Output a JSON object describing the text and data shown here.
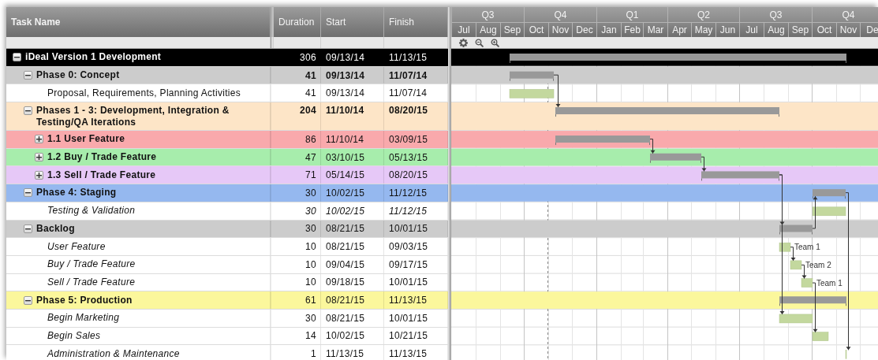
{
  "columns": [
    {
      "label": "Task Name"
    },
    {
      "label": "Duration"
    },
    {
      "label": "Start"
    },
    {
      "label": "Finish"
    }
  ],
  "timeline": {
    "quarters": [
      {
        "label": "Q3",
        "months": [
          "Jul",
          "Aug",
          "Sep"
        ]
      },
      {
        "label": "Q4",
        "months": [
          "Oct",
          {
            "label": "Nov",
            "today": true
          },
          "Dec"
        ]
      },
      {
        "label": "Q1",
        "months": [
          "Jan",
          "Feb",
          "Mar"
        ]
      },
      {
        "label": "Q2",
        "months": [
          "Apr",
          "May",
          "Jun"
        ]
      },
      {
        "label": "Q3",
        "months": [
          "Jul",
          "Aug",
          "Sep"
        ]
      },
      {
        "label": "Q4",
        "months": [
          "Oct",
          "Nov",
          "De"
        ]
      }
    ]
  },
  "rows": [
    {
      "name": "iDeal Version 1 Development",
      "kind": "group",
      "expanded": true,
      "color": "#000000",
      "duration": "306",
      "start": "09/13/14",
      "finish": "11/13/15",
      "children": [
        {
          "name": "Phase 0: Concept",
          "kind": "summary",
          "expanded": true,
          "color": "#cccccc",
          "duration": "41",
          "start": "09/13/14",
          "finish": "11/07/14",
          "children": [
            {
              "name": "Proposal, Requirements, Planning Activities",
              "kind": "task",
              "italic": false,
              "duration": "41",
              "start": "09/13/14",
              "finish": "11/07/14"
            }
          ]
        },
        {
          "name": "Phases 1 - 3: Development, Integration & Testing/QA Iterations",
          "kind": "summary",
          "expanded": true,
          "color": "#fde5c7",
          "duration": "204",
          "start": "11/10/14",
          "finish": "08/20/15",
          "children": [
            {
              "name": "1.1 User Feature",
              "kind": "group",
              "expanded": false,
              "color": "#f9a9ac",
              "duration": "86",
              "start": "11/10/14",
              "finish": "03/09/15"
            },
            {
              "name": "1.2 Buy / Trade Feature",
              "kind": "group",
              "expanded": false,
              "color": "#a7edac",
              "duration": "47",
              "start": "03/10/15",
              "finish": "05/13/15"
            },
            {
              "name": "1.3 Sell / Trade Feature",
              "kind": "group",
              "expanded": false,
              "color": "#e6c8f7",
              "duration": "71",
              "start": "05/14/15",
              "finish": "08/20/15"
            }
          ]
        },
        {
          "name": "Phase 4: Staging",
          "kind": "group",
          "expanded": true,
          "color": "#95b8ef",
          "duration": "30",
          "start": "10/02/15",
          "finish": "11/12/15",
          "children": [
            {
              "name": "Testing & Validation",
              "kind": "task",
              "italic": true,
              "italic_values": true,
              "duration": "30",
              "start": "10/02/15",
              "finish": "11/12/15"
            }
          ]
        },
        {
          "name": "Backlog",
          "kind": "group",
          "expanded": true,
          "color": "#cccccc",
          "duration": "30",
          "start": "08/21/15",
          "finish": "10/01/15",
          "children": [
            {
              "name": "User Feature",
              "kind": "task",
              "italic": true,
              "duration": "10",
              "start": "08/21/15",
              "finish": "09/03/15",
              "bar_label": "Team 1"
            },
            {
              "name": "Buy / Trade Feature",
              "kind": "task",
              "italic": true,
              "duration": "10",
              "start": "09/04/15",
              "finish": "09/17/15",
              "bar_label": "Team 2"
            },
            {
              "name": "Sell / Trade Feature",
              "kind": "task",
              "italic": true,
              "duration": "10",
              "start": "09/18/15",
              "finish": "10/01/15",
              "bar_label": "Team 1"
            }
          ]
        },
        {
          "name": "Phase 5: Production",
          "kind": "group",
          "expanded": true,
          "color": "#fbf79c",
          "duration": "61",
          "start": "08/21/15",
          "finish": "11/13/15",
          "children": [
            {
              "name": "Begin Marketing",
              "kind": "task",
              "italic": true,
              "duration": "30",
              "start": "08/21/15",
              "finish": "10/01/15"
            },
            {
              "name": "Begin Sales",
              "kind": "task",
              "italic": true,
              "duration": "14",
              "start": "10/02/15",
              "finish": "10/21/15"
            },
            {
              "name": "Administration & Maintenance",
              "kind": "task",
              "italic": true,
              "duration": "1",
              "start": "11/13/15",
              "finish": "11/13/15"
            }
          ]
        }
      ]
    }
  ]
}
